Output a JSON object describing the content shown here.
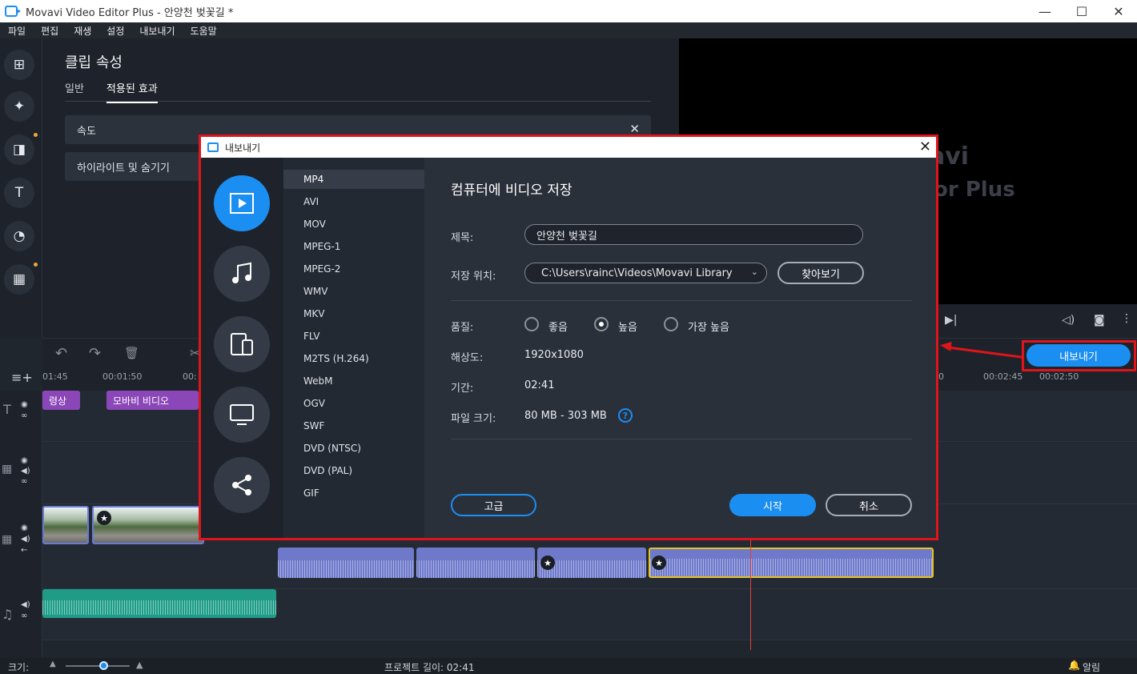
{
  "window": {
    "title": "Movavi Video Editor Plus - 안양천 벚꽃길 *",
    "minimize": "—",
    "maximize": "☐",
    "close": "✕"
  },
  "menu": [
    "파일",
    "편집",
    "재생",
    "설정",
    "내보내기",
    "도움말"
  ],
  "left_tools": [
    "add-media-icon",
    "magic-wand-icon",
    "transitions-icon",
    "titles-icon",
    "filters-icon",
    "more-tools-icon"
  ],
  "props": {
    "title": "클립 속성",
    "tabs": [
      "일반",
      "적용된 효과"
    ],
    "effects": [
      "속도",
      "하이라이트 및 숨기기"
    ]
  },
  "preview": {
    "line1": "avi",
    "line2": "or Plus"
  },
  "timeline": {
    "ruler": [
      "01:45",
      "00:01:50",
      "00:",
      "0",
      "00:02:45",
      "00:02:50"
    ],
    "title_clips": [
      "령상",
      "모바비 비디오"
    ]
  },
  "export_button": "내보내기",
  "status": {
    "size_label": "크기:",
    "project_length": "프로젝트 길이: 02:41",
    "alerts": "알림"
  },
  "dialog": {
    "title": "내보내기",
    "formats": [
      "MP4",
      "AVI",
      "MOV",
      "MPEG-1",
      "MPEG-2",
      "WMV",
      "MKV",
      "FLV",
      "M2TS (H.264)",
      "WebM",
      "OGV",
      "SWF",
      "DVD (NTSC)",
      "DVD (PAL)",
      "GIF"
    ],
    "heading": "컴퓨터에 비디오 저장",
    "name_label": "제목:",
    "name_value": "안양천 벚꽃길",
    "location_label": "저장 위치:",
    "location_value": "C:\\Users\\rainc\\Videos\\Movavi Library",
    "browse": "찾아보기",
    "quality_label": "품질:",
    "quality_options": [
      "좋음",
      "높음",
      "가장 높음"
    ],
    "quality_selected": "높음",
    "resolution_label": "해상도:",
    "resolution_value": "1920x1080",
    "duration_label": "기간:",
    "duration_value": "02:41",
    "filesize_label": "파일 크기:",
    "filesize_value": "80 MB - 303 MB",
    "advanced": "고급",
    "start": "시작",
    "cancel": "취소"
  },
  "colors": {
    "accent": "#1b8ef2",
    "highlight": "#e0141b"
  }
}
